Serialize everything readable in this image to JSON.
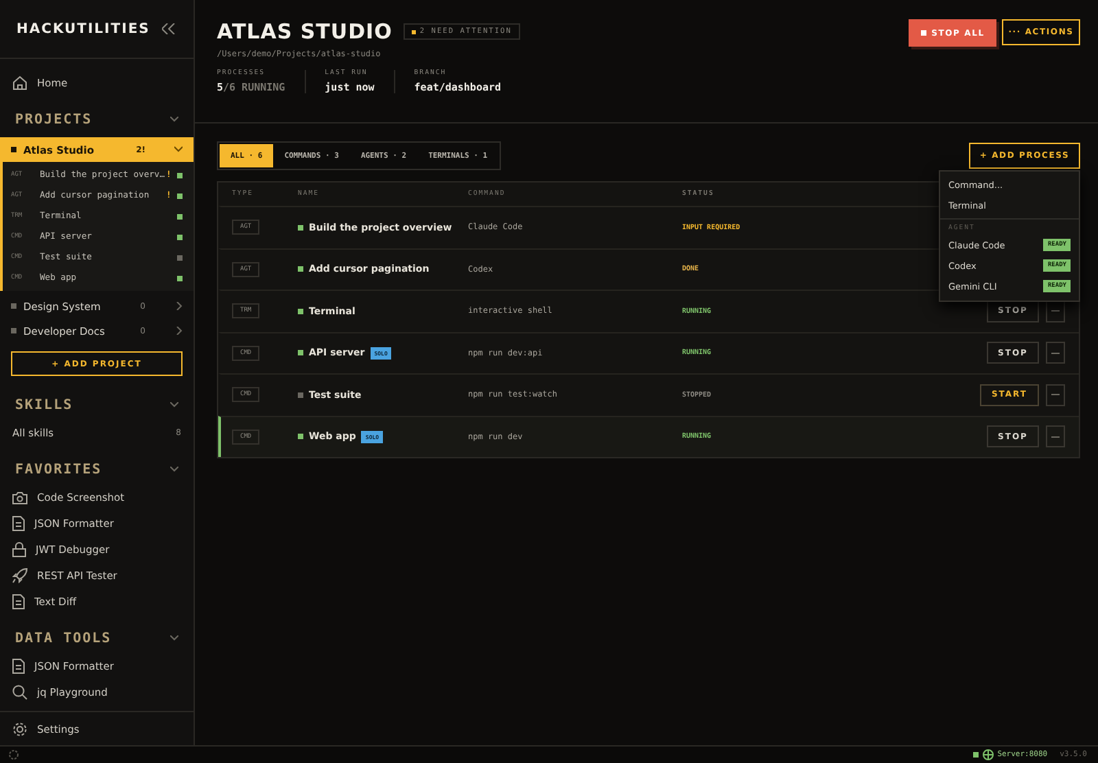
{
  "sidebar": {
    "brand": "HACKUTILITIES",
    "home": "Home",
    "projects": {
      "title": "PROJECTS",
      "expanded": true,
      "items": [
        {
          "name": "Atlas Studio",
          "badge": "2!",
          "selected": true,
          "expanded": true,
          "children": [
            {
              "type": "AGT",
              "name": "Build the project overv…",
              "flag": "!",
              "running": true
            },
            {
              "type": "AGT",
              "name": "Add cursor pagination",
              "flag": "!",
              "running": true
            },
            {
              "type": "TRM",
              "name": "Terminal",
              "running": true
            },
            {
              "type": "CMD",
              "name": "API server",
              "running": true
            },
            {
              "type": "CMD",
              "name": "Test suite",
              "running": false
            },
            {
              "type": "CMD",
              "name": "Web app",
              "running": true
            }
          ]
        },
        {
          "name": "Design System",
          "badge": "0",
          "selected": false,
          "expanded": false
        },
        {
          "name": "Developer Docs",
          "badge": "0",
          "selected": false,
          "expanded": false
        }
      ]
    },
    "add_project": "+ ADD PROJECT",
    "sections": [
      {
        "title": "SKILLS",
        "expanded": true,
        "items": [
          {
            "label": "All skills",
            "count": "8"
          }
        ]
      },
      {
        "title": "FAVORITES",
        "expanded": true,
        "items": [
          {
            "label": "Code Screenshot"
          },
          {
            "label": "JSON Formatter"
          },
          {
            "label": "JWT Debugger"
          },
          {
            "label": "REST API Tester"
          },
          {
            "label": "Text Diff"
          }
        ]
      },
      {
        "title": "DATA TOOLS",
        "expanded": true,
        "items": [
          {
            "label": "JSON Formatter"
          },
          {
            "label": "jq Playground"
          }
        ]
      }
    ],
    "settings": "Settings"
  },
  "header": {
    "title": "ATLAS STUDIO",
    "attention_badge": "2 NEED ATTENTION",
    "path": "/Users/demo/Projects/atlas-studio",
    "stats": [
      {
        "label": "PROCESSES",
        "value": "**5**/6 RUNNING"
      },
      {
        "label": "LAST RUN",
        "value": "just now"
      },
      {
        "label": "BRANCH",
        "value": "feat/dashboard"
      }
    ],
    "buttons": [
      {
        "kind": "danger",
        "label": "STOP ALL"
      },
      {
        "kind": "outline",
        "label": "··· ACTIONS"
      }
    ]
  },
  "tabs": [
    {
      "label": "ALL · 6",
      "selected": true
    },
    {
      "label": "COMMANDS · 3",
      "selected": false
    },
    {
      "label": "AGENTS · 2",
      "selected": false
    },
    {
      "label": "TERMINALS · 1",
      "selected": false
    }
  ],
  "add_process": "+ ADD PROCESS",
  "table": {
    "columns": [
      "TYPE",
      "NAME",
      "COMMAND",
      "STATUS"
    ],
    "rows": [
      {
        "type": "AGT",
        "name": "Build the project overview",
        "command": "Claude Code",
        "status": "INPUT REQUIRED",
        "kind": "attention",
        "selected": false
      },
      {
        "type": "AGT",
        "name": "Add cursor pagination",
        "command": "Codex",
        "status": "DONE",
        "kind": "done",
        "selected": false
      },
      {
        "type": "TRM",
        "name": "Terminal",
        "command": "interactive shell",
        "status": "RUNNING",
        "kind": "running",
        "action": "STOP",
        "selected": false
      },
      {
        "type": "CMD",
        "name": "API server",
        "badge": "SOLO",
        "command": "npm run dev:api",
        "status": "RUNNING",
        "kind": "running",
        "action": "STOP",
        "selected": false
      },
      {
        "type": "CMD",
        "name": "Test suite",
        "command": "npm run test:watch",
        "status": "STOPPED",
        "kind": "stopped",
        "action": "START",
        "selected": false
      },
      {
        "type": "CMD",
        "name": "Web app",
        "badge": "SOLO",
        "command": "npm run dev",
        "status": "RUNNING",
        "kind": "running",
        "action": "STOP",
        "selected": true
      }
    ]
  },
  "menu": {
    "items": [
      "Command...",
      "Terminal"
    ],
    "group": "AGENT",
    "agents": [
      {
        "name": "Claude Code",
        "status": "READY"
      },
      {
        "name": "Codex",
        "status": "READY"
      },
      {
        "name": "Gemini CLI",
        "status": "READY"
      }
    ]
  },
  "status_bar": {
    "server": "Server:8080",
    "version": "v3.5.0",
    "online": true
  }
}
